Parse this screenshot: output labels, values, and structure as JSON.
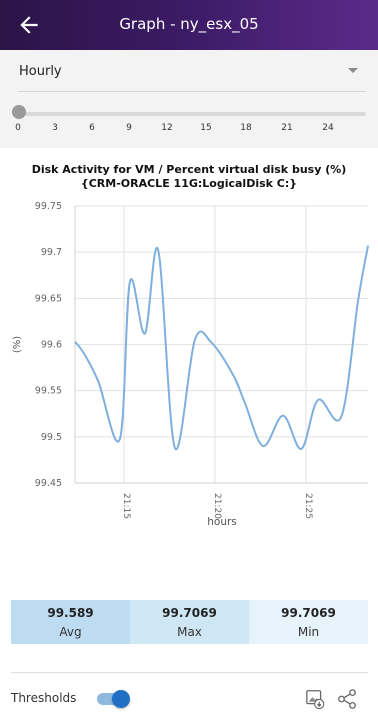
{
  "header": {
    "title": "Graph - ny_esx_05",
    "back_icon": "arrow-left-icon"
  },
  "filter": {
    "interval": "Hourly",
    "slider_value": 0,
    "slider_ticks": [
      "0",
      "3",
      "6",
      "9",
      "12",
      "15",
      "18",
      "21",
      "24"
    ]
  },
  "colors": {
    "accent": "#2f74c0",
    "line": "#7fb0dd",
    "stat_bg_1": "#bedcf1",
    "stat_bg_2": "#cfe7f5",
    "stat_bg_3": "#e6f3fa"
  },
  "chart_data": {
    "type": "line",
    "title": "Disk Activity for VM / Percent virtual disk busy (%) {CRM-ORACLE 11G:LogicalDisk C:}",
    "xlabel": "hours",
    "ylabel": "(%)",
    "ylim": [
      99.45,
      99.75
    ],
    "y_ticks": [
      "99.75",
      "99.7",
      "99.65",
      "99.6",
      "99.55",
      "99.5",
      "99.45"
    ],
    "x_ticks": [
      "21:15",
      "21:20",
      "21:25"
    ],
    "grid": true,
    "series": [
      {
        "x": [
          0,
          0.55,
          1.4,
          2.7,
          3.3,
          4.2,
          5.0,
          6.0,
          7.2,
          8.2,
          9.5,
          10.2,
          11.3,
          12.5,
          13.6,
          14.6,
          16.0,
          17.0,
          17.6
        ],
        "y": [
          99.603,
          99.59,
          99.56,
          99.498,
          99.668,
          99.612,
          99.702,
          99.488,
          99.605,
          99.602,
          99.567,
          99.537,
          99.49,
          99.523,
          99.487,
          99.54,
          99.522,
          99.647,
          99.707
        ]
      }
    ]
  },
  "stats": [
    {
      "value": "99.589",
      "label": "Avg"
    },
    {
      "value": "99.7069",
      "label": "Max"
    },
    {
      "value": "99.7069",
      "label": "Min"
    }
  ],
  "footer": {
    "thresholds_label": "Thresholds",
    "thresholds_on": true,
    "download_icon": "image-download-icon",
    "share_icon": "share-icon"
  }
}
